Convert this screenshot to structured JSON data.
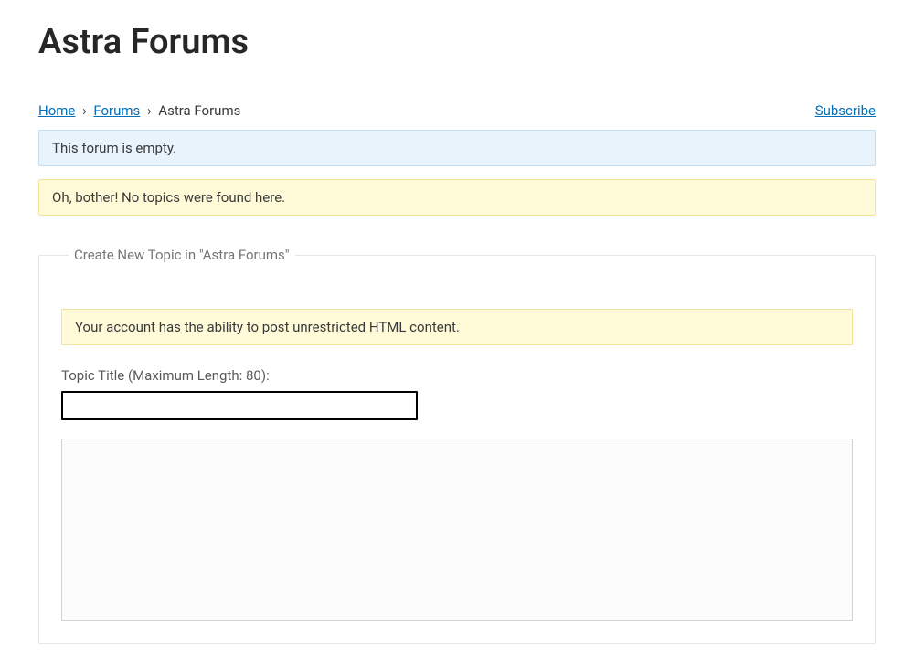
{
  "page": {
    "title": "Astra Forums"
  },
  "breadcrumbs": {
    "home_label": "Home",
    "forums_label": "Forums",
    "current": "Astra Forums",
    "sep": "›"
  },
  "actions": {
    "subscribe_label": "Subscribe"
  },
  "notices": {
    "empty_forum": "This forum is empty.",
    "no_topics": "Oh, bother! No topics were found here."
  },
  "form": {
    "legend": "Create New Topic in \"Astra Forums\"",
    "capability_notice": "Your account has the ability to post unrestricted HTML content.",
    "title_label": "Topic Title (Maximum Length: 80):",
    "title_value": ""
  }
}
